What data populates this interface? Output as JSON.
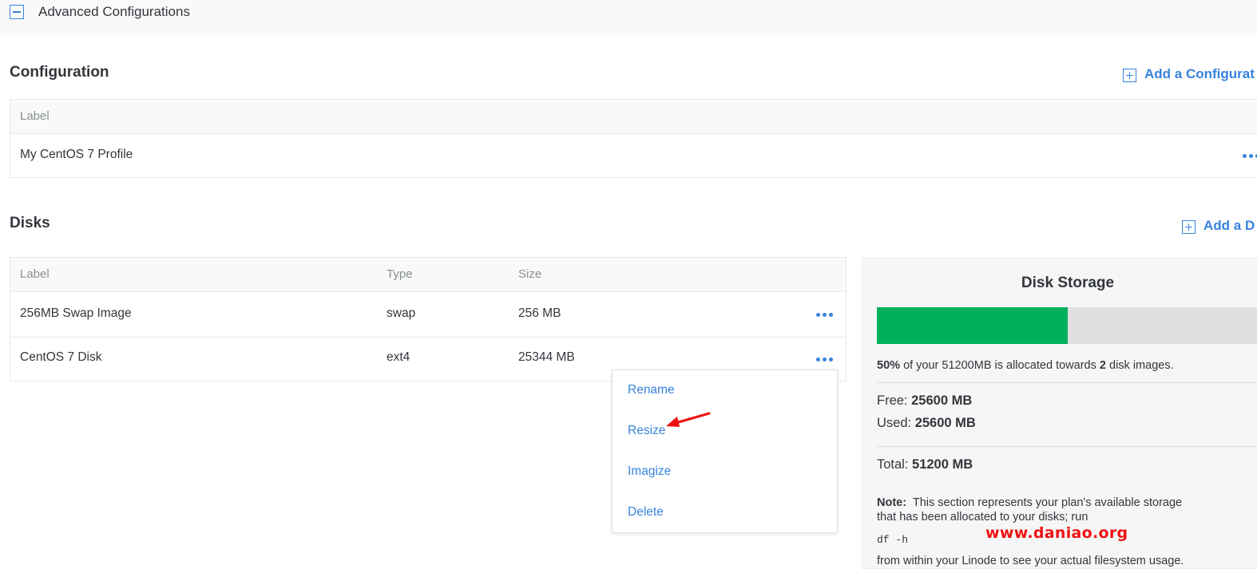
{
  "advanced": {
    "title": "Advanced Configurations"
  },
  "configuration": {
    "title": "Configuration",
    "add_label": "Add a Configurat",
    "columns": [
      "Label"
    ],
    "rows": [
      {
        "label": "My CentOS 7 Profile"
      }
    ]
  },
  "disks": {
    "title": "Disks",
    "add_label": "Add a D",
    "columns": [
      "Label",
      "Type",
      "Size"
    ],
    "rows": [
      {
        "label": "256MB Swap Image",
        "type": "swap",
        "size": "256 MB"
      },
      {
        "label": "CentOS 7 Disk",
        "type": "ext4",
        "size": "25344 MB"
      }
    ],
    "action_menu": [
      "Rename",
      "Resize",
      "Imagize",
      "Delete"
    ]
  },
  "storage": {
    "title": "Disk Storage",
    "percent_allocated": 0.5,
    "summary": {
      "percent": "50%",
      "text_a": "of your 51200MB is allocated towards",
      "count": "2",
      "text_b": "disk images."
    },
    "free_label": "Free:",
    "free_value": "25600 MB",
    "used_label": "Used:",
    "used_value": "25600 MB",
    "total_label": "Total:",
    "total_value": "51200 MB",
    "note_label": "Note:",
    "note_line1": "This section represents your plan's available storage",
    "note_line2": "that has been allocated to your disks; run",
    "command": "df -h",
    "note_line3": "from within your Linode to see your actual filesystem usage."
  },
  "watermark": "www.daniao.org",
  "colors": {
    "accent": "#3683dc",
    "bar_fill": "#00b05a",
    "bar_track": "#e0e0e0",
    "annotation": "#ee1111"
  }
}
